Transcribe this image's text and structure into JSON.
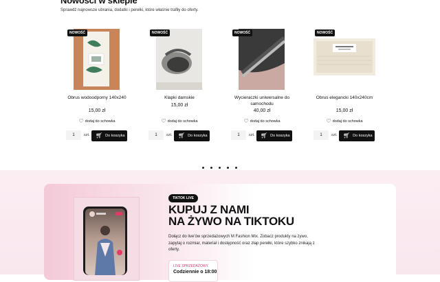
{
  "section": {
    "title": "Nowości w sklepie",
    "subtitle": "Sprawdź najnowsze ubrania, dodatki i perełki, które właśnie trafiły do oferty."
  },
  "products": [
    {
      "badge": "NOWOŚĆ",
      "name": "Obrus wodoodporny 140x240",
      "price": "15,00 zł",
      "wish": "dodaj do schowka",
      "qty": "1",
      "unit": "szt.",
      "cart": "Do koszyka"
    },
    {
      "badge": "NOWOŚĆ",
      "name": "Klapki damskie",
      "price": "15,00 zł",
      "wish": "dodaj do schowka",
      "qty": "1",
      "unit": "szt.",
      "cart": "Do koszyka"
    },
    {
      "badge": "NOWOŚĆ",
      "name": "Wycieraczki uniwersalne do samochodu",
      "price": "40,00 zł",
      "wish": "dodaj do schowka",
      "qty": "1",
      "unit": "szt.",
      "cart": "Do koszyka"
    },
    {
      "badge": "NOWOŚĆ",
      "name": "Obrus elegancki 140x240cm",
      "price": "15,00 zł",
      "wish": "dodaj do schowka",
      "qty": "1",
      "unit": "szt.",
      "cart": "Do koszyka"
    }
  ],
  "live": {
    "tag": "TIKTOK LIVE",
    "title_line1": "KUPUJ Z NAMI",
    "title_line2": "NA ŻYWO NA TIKTOKU",
    "description": "Dołącz do live'ów sprzedażowych M Fashion Mix. Zobacz produkty na żywo, zapytaj o rozmiar, materiał i dostępność oraz złap perełki, które szybko znikają z oferty.",
    "schedule_label": "LIVE SPRZEDAŻOWY",
    "schedule_value": "Codziennie o 18:00"
  },
  "icons": {
    "heart": "heart-icon",
    "cart": "cart-icon"
  },
  "colors": {
    "accent": "#111111",
    "pink": "#f9e7ee",
    "live_label": "#d23a6e"
  }
}
